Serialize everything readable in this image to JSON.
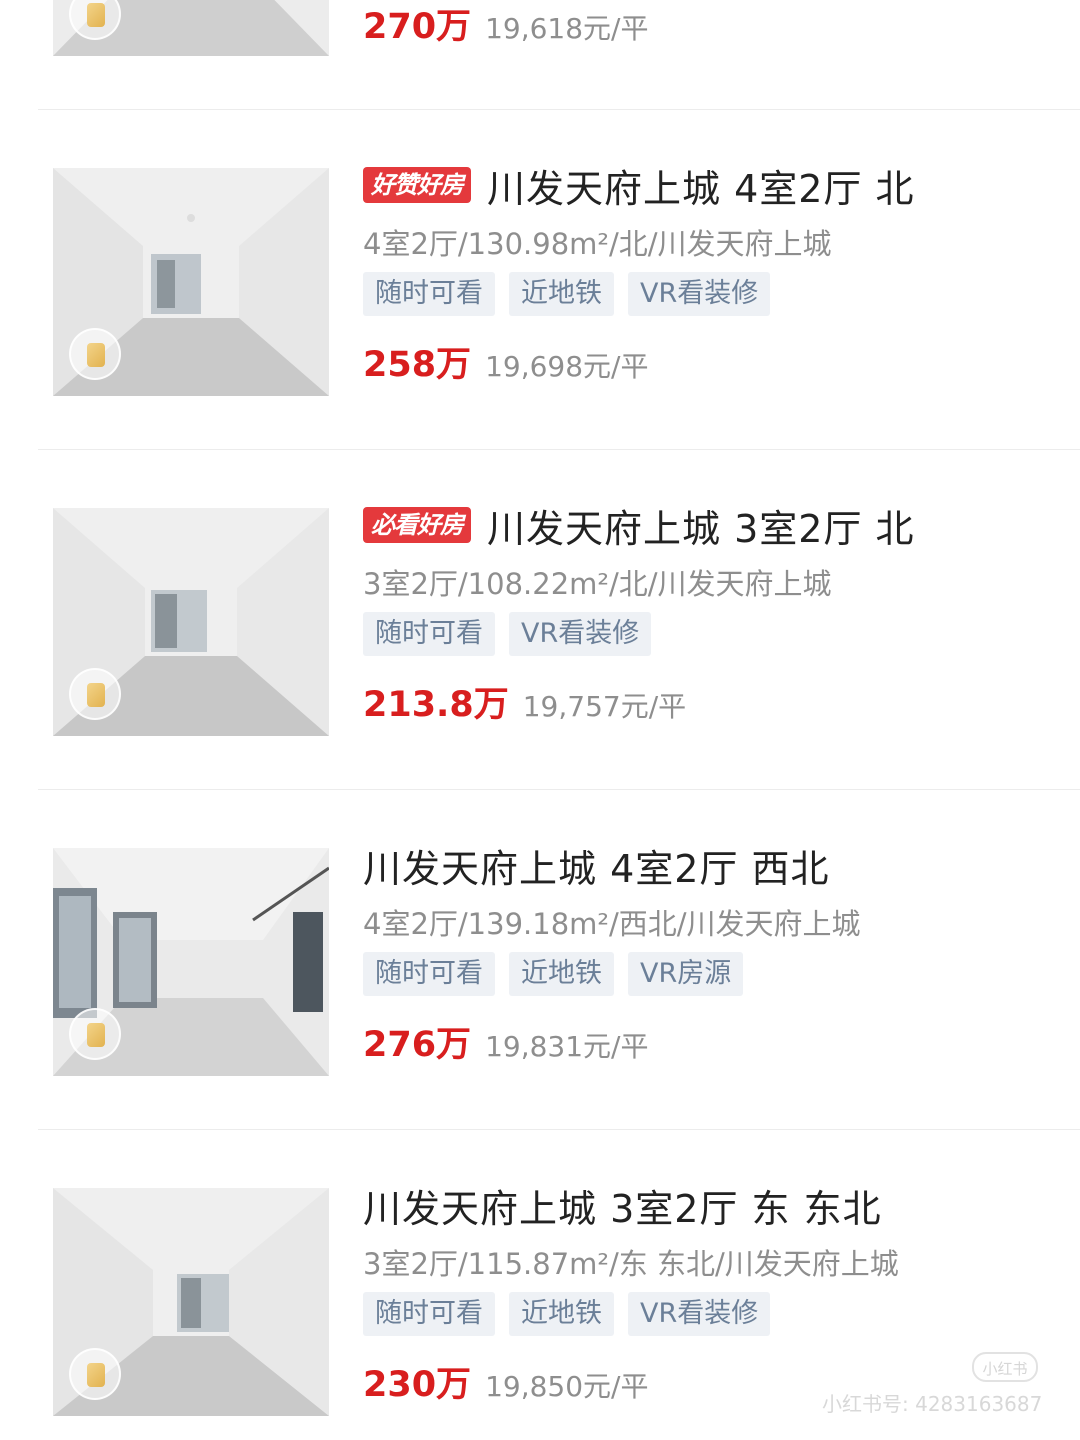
{
  "listings": [
    {
      "price": "270万",
      "unit_price": "19,618元/平"
    },
    {
      "badge": "好赞好房",
      "title": "川发天府上城 4室2厅 北",
      "specs": "4室2厅/130.98m²/北/川发天府上城",
      "tags": [
        "随时可看",
        "近地铁",
        "VR看装修"
      ],
      "price": "258万",
      "unit_price": "19,698元/平"
    },
    {
      "badge": "必看好房",
      "title": "川发天府上城 3室2厅 北",
      "specs": "3室2厅/108.22m²/北/川发天府上城",
      "tags": [
        "随时可看",
        "VR看装修"
      ],
      "price": "213.8万",
      "unit_price": "19,757元/平"
    },
    {
      "title": "川发天府上城 4室2厅 西北",
      "specs": "4室2厅/139.18m²/西北/川发天府上城",
      "tags": [
        "随时可看",
        "近地铁",
        "VR房源"
      ],
      "price": "276万",
      "unit_price": "19,831元/平"
    },
    {
      "title": "川发天府上城 3室2厅 东 东北",
      "specs": "3室2厅/115.87m²/东 东北/川发天府上城",
      "tags": [
        "随时可看",
        "近地铁",
        "VR看装修"
      ],
      "price": "230万",
      "unit_price": "19,850元/平"
    }
  ],
  "watermark": {
    "logo": "小红书",
    "text": "小红书号: 4283163687"
  },
  "colors": {
    "price": "#d81e1e",
    "badge": "#e4393c",
    "tag_bg": "#eef1f5",
    "tag_text": "#6b7f98"
  }
}
